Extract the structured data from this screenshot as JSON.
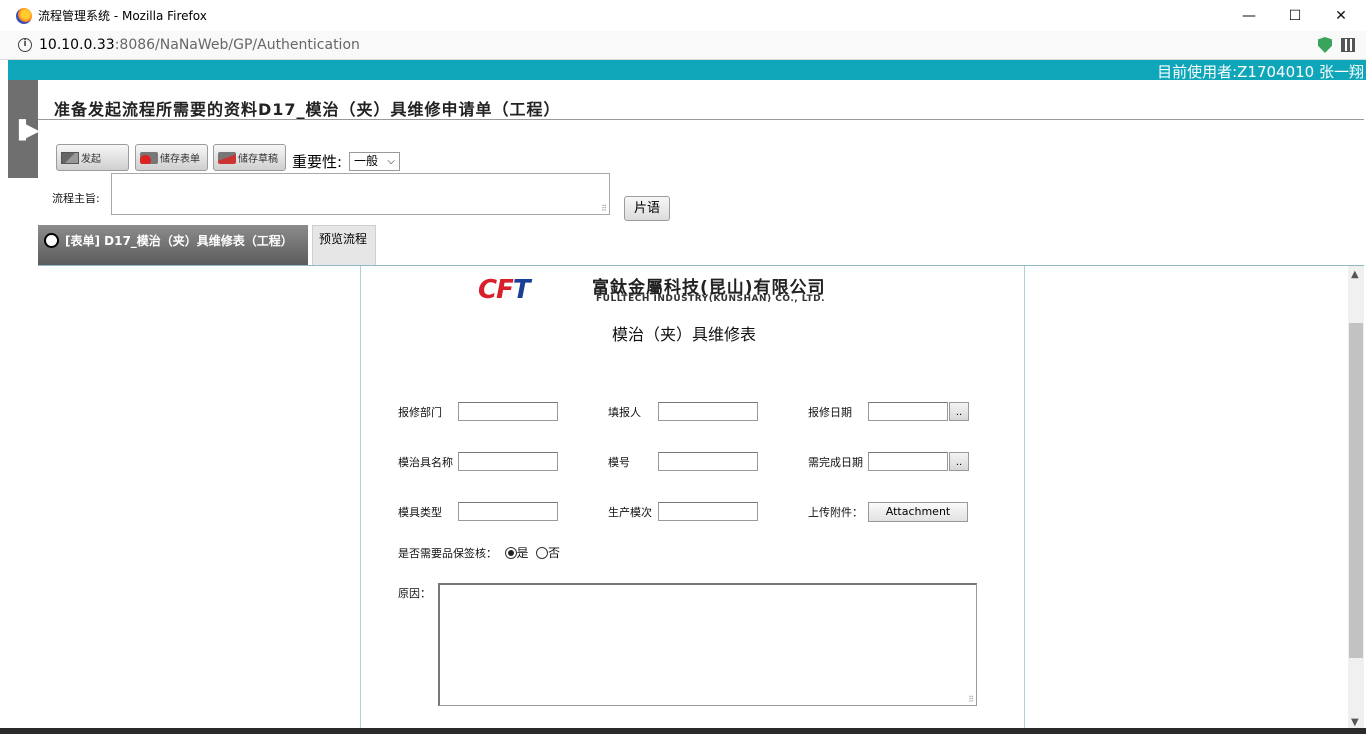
{
  "window": {
    "title": "流程管理系统 - Mozilla Firefox",
    "minimize": "—",
    "maximize": "☐",
    "close": "✕"
  },
  "address": {
    "host": "10.10.0.33",
    "rest": ":8086/NaNaWeb/GP/Authentication"
  },
  "userbar": {
    "text": "目前使用者:Z1704010 张一翔"
  },
  "header": {
    "title": "准备发起流程所需要的资料D17_模治（夹）具维修申请单（工程）"
  },
  "toolbar": {
    "send_label": "发起",
    "save_form_label": "储存表单",
    "save_draft_label": "储存草稿",
    "importance_label": "重要性:",
    "importance_value": "一般"
  },
  "subject": {
    "label": "流程主旨:",
    "value": "",
    "phrase_button": "片语"
  },
  "tabs": [
    {
      "label": "[表单] D17_模治（夹）具维修表（工程）",
      "active": true
    },
    {
      "label": "预览流程",
      "active": false
    }
  ],
  "form": {
    "logo_mark_c": "CF",
    "logo_mark_t": "T",
    "logo_cn": "富鈦金屬科技(昆山)有限公司",
    "logo_en": "FULLTECH  INDUSTRY(KUNSHAN)  CO., LTD.",
    "title": "模治（夹）具维修表",
    "fields": {
      "repair_dept": {
        "label": "报修部门",
        "value": ""
      },
      "reporter": {
        "label": "填报人",
        "value": ""
      },
      "repair_date": {
        "label": "报修日期",
        "value": "",
        "button": ".."
      },
      "tool_name": {
        "label": "模治具名称",
        "value": ""
      },
      "mold_no": {
        "label": "模号",
        "value": ""
      },
      "due_date": {
        "label": "需完成日期",
        "value": "",
        "button": ".."
      },
      "mold_type": {
        "label": "模具类型",
        "value": ""
      },
      "production_lot": {
        "label": "生产模次",
        "value": ""
      },
      "upload": {
        "label": "上传附件：",
        "button": "Attachment"
      }
    },
    "qa_review": {
      "label": "是否需要品保签核：",
      "options": [
        "是",
        "否"
      ],
      "selected": "是"
    },
    "reason": {
      "label": "原因：",
      "value": ""
    }
  },
  "colors": {
    "userbar": "#10a6b9",
    "tab_active": "#6e6e6e",
    "logo_red": "#d8202c",
    "logo_blue": "#1c3f96"
  }
}
